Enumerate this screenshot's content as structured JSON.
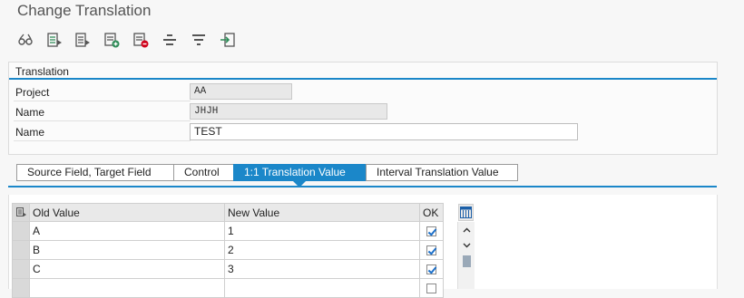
{
  "window": {
    "title": "Change Translation"
  },
  "toolbar": {
    "icons": [
      "glasses-display-icon",
      "select-row-icon",
      "details-icon",
      "add-row-icon",
      "delete-row-icon",
      "align-center-icon",
      "filter-icon",
      "import-icon"
    ]
  },
  "group": {
    "title": "Translation",
    "fields": [
      {
        "label": "Project",
        "value": "AA"
      },
      {
        "label": "Name",
        "value": "JHJH"
      },
      {
        "label": "Name",
        "value": "TEST"
      }
    ]
  },
  "tabs": [
    {
      "label": "Source Field, Target Field"
    },
    {
      "label": "Control"
    },
    {
      "label": "1:1 Translation Value"
    },
    {
      "label": "Interval Translation Value"
    }
  ],
  "table": {
    "headers": {
      "old_value": "Old Value",
      "new_value": "New Value",
      "ok": "OK"
    },
    "rows": [
      {
        "old_value": "A",
        "new_value": "1",
        "ok": true
      },
      {
        "old_value": "B",
        "new_value": "2",
        "ok": true
      },
      {
        "old_value": "C",
        "new_value": "3",
        "ok": true
      },
      {
        "old_value": "",
        "new_value": "",
        "ok": false
      }
    ]
  },
  "colors": {
    "accent": "#1b87c9",
    "checkmark": "#1b6fc9"
  }
}
